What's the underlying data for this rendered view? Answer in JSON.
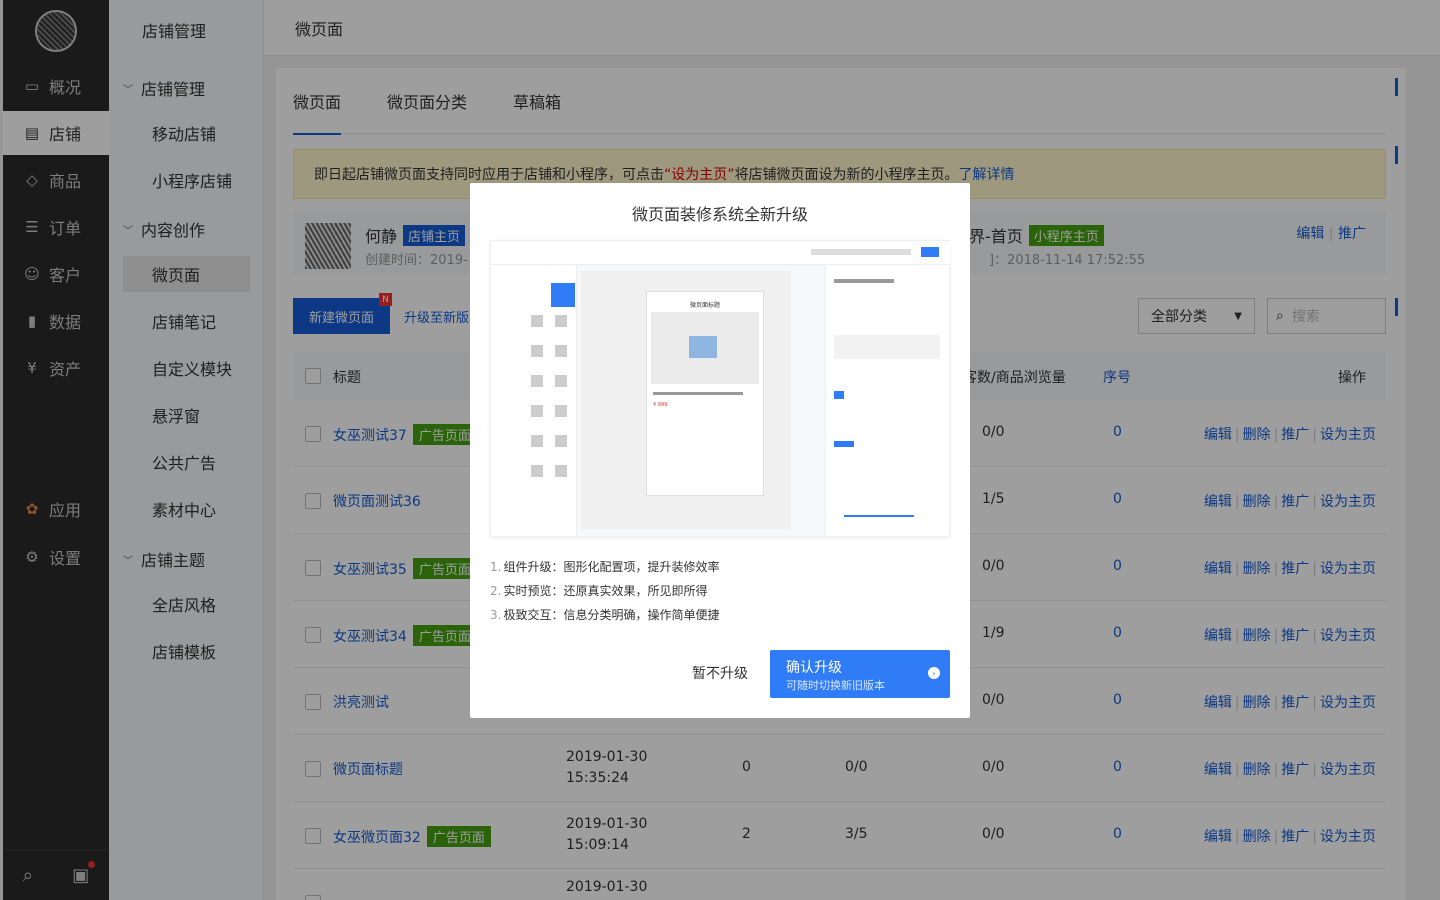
{
  "nav": {
    "items": [
      {
        "label": "概况",
        "icon": "monitor-icon"
      },
      {
        "label": "店铺",
        "icon": "store-icon"
      },
      {
        "label": "商品",
        "icon": "tag-icon"
      },
      {
        "label": "订单",
        "icon": "list-icon"
      },
      {
        "label": "客户",
        "icon": "user-icon"
      },
      {
        "label": "数据",
        "icon": "bar-chart-icon"
      },
      {
        "label": "资产",
        "icon": "yen-icon"
      },
      {
        "label": "应用",
        "icon": "apps-icon"
      },
      {
        "label": "设置",
        "icon": "gear-icon"
      }
    ]
  },
  "subnav": {
    "title": "店铺管理",
    "groups": [
      {
        "label": "店铺管理",
        "items": [
          "移动店铺",
          "小程序店铺"
        ]
      },
      {
        "label": "内容创作",
        "items": [
          "微页面",
          "店铺笔记",
          "自定义模块",
          "悬浮窗",
          "公共广告",
          "素材中心"
        ]
      },
      {
        "label": "店铺主题",
        "items": [
          "全店风格",
          "店铺模板"
        ]
      }
    ]
  },
  "header": {
    "title": "微页面"
  },
  "tabs": [
    "微页面",
    "微页面分类",
    "草稿箱"
  ],
  "notice": {
    "prefix": "即日起店铺微页面支持同时应用于店铺和小程序，可点击",
    "highlight": "“设为主页”",
    "suffix": "将店铺微页面设为新的小程序主页。",
    "link": "了解详情"
  },
  "homecard": {
    "name": "何静",
    "badge": "店铺主页",
    "time": "创建时间：2019-",
    "name2": "界-首页",
    "badge2": "小程序主页",
    "time2": "]：2018-11-14 17:52:55",
    "edit": "编辑",
    "promote": "推广"
  },
  "toolbar": {
    "new_button": "新建微页面",
    "new_badge": "N",
    "upgrade_link": "升级至新版",
    "category": "全部分类",
    "search_placeholder": "搜索"
  },
  "table": {
    "headers": {
      "title": "标题",
      "visits": "客数/商品浏览量",
      "order": "序号",
      "ops": "操作"
    },
    "ops": [
      "编辑",
      "删除",
      "推广",
      "设为主页"
    ],
    "rows": [
      {
        "title": "女巫测试37",
        "tag": "广告页面",
        "date": "",
        "time": "",
        "c1": "",
        "c2": "",
        "c3": "0/0",
        "order": "0"
      },
      {
        "title": "微页面测试36",
        "tag": "",
        "date": "",
        "time": "",
        "c1": "",
        "c2": "",
        "c3": "1/5",
        "order": "0"
      },
      {
        "title": "女巫测试35",
        "tag": "广告页面",
        "date": "",
        "time": "",
        "c1": "",
        "c2": "",
        "c3": "0/0",
        "order": "0"
      },
      {
        "title": "女巫测试34",
        "tag": "广告页面",
        "date": "",
        "time": "",
        "c1": "",
        "c2": "",
        "c3": "1/9",
        "order": "0"
      },
      {
        "title": "洪亮测试",
        "tag": "",
        "date": "",
        "time": "",
        "c1": "",
        "c2": "",
        "c3": "0/0",
        "order": "0"
      },
      {
        "title": "微页面标题",
        "tag": "",
        "date": "2019-01-30",
        "time": "15:35:24",
        "c1": "0",
        "c2": "0/0",
        "c3": "0/0",
        "order": "0"
      },
      {
        "title": "女巫微页面32",
        "tag": "广告页面",
        "date": "2019-01-30",
        "time": "15:09:14",
        "c1": "2",
        "c2": "3/5",
        "c3": "0/0",
        "order": "0"
      },
      {
        "title": "",
        "tag": "",
        "date": "2019-01-30",
        "time": "",
        "c1": "",
        "c2": "",
        "c3": "",
        "order": ""
      }
    ]
  },
  "modal": {
    "title": "微页面装修系统全新升级",
    "features": [
      {
        "n": "1.",
        "text": "组件升级：图形化配置项，提升装修效率"
      },
      {
        "n": "2.",
        "text": "实时预览：还原真实效果，所见即所得"
      },
      {
        "n": "3.",
        "text": "极致交互：信息分类明确，操作简单便捷"
      }
    ],
    "cancel": "暂不升级",
    "confirm": "确认升级",
    "confirm_sub": "可随时切换新旧版本",
    "preview_page_title": "微页面标题",
    "preview_price": "¥ 999"
  },
  "colors": {
    "primary": "#155bd4",
    "tag_green": "#45a110",
    "nav_bg": "#2b2b2b"
  }
}
